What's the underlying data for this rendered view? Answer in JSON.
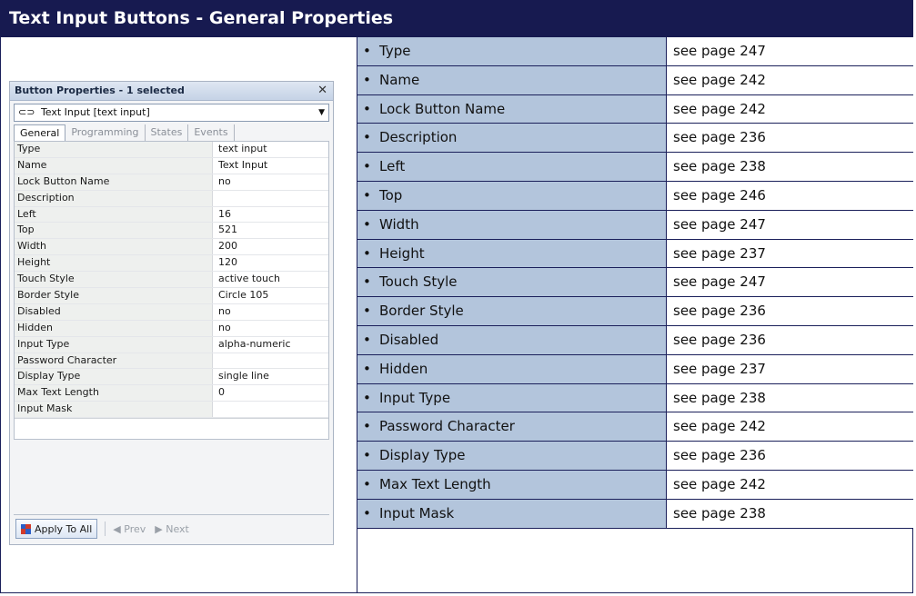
{
  "page_title": "Text Input Buttons - General Properties",
  "panel": {
    "title": "Button Properties - 1 selected",
    "selector_value": "Text Input  [text input]",
    "tabs": [
      "General",
      "Programming",
      "States",
      "Events"
    ],
    "properties": [
      {
        "key": "Type",
        "value": "text input"
      },
      {
        "key": "Name",
        "value": "Text Input"
      },
      {
        "key": "Lock Button Name",
        "value": "no"
      },
      {
        "key": "Description",
        "value": ""
      },
      {
        "key": "Left",
        "value": "16"
      },
      {
        "key": "Top",
        "value": "521"
      },
      {
        "key": "Width",
        "value": "200"
      },
      {
        "key": "Height",
        "value": "120"
      },
      {
        "key": "Touch Style",
        "value": "active touch"
      },
      {
        "key": "Border Style",
        "value": "Circle 105"
      },
      {
        "key": "Disabled",
        "value": "no"
      },
      {
        "key": "Hidden",
        "value": "no"
      },
      {
        "key": "Input Type",
        "value": "alpha-numeric"
      },
      {
        "key": "Password Character",
        "value": ""
      },
      {
        "key": "Display Type",
        "value": "single line"
      },
      {
        "key": "Max Text Length",
        "value": "0"
      },
      {
        "key": "Input Mask",
        "value": ""
      }
    ],
    "apply_label": "Apply To All",
    "prev_label": "Prev",
    "next_label": "Next"
  },
  "references": [
    {
      "name": "Type",
      "page": "see page 247"
    },
    {
      "name": "Name",
      "page": "see page 242"
    },
    {
      "name": "Lock Button Name",
      "page": "see page 242"
    },
    {
      "name": "Description",
      "page": "see page 236"
    },
    {
      "name": "Left",
      "page": "see page 238"
    },
    {
      "name": "Top",
      "page": "see page 246"
    },
    {
      "name": "Width",
      "page": "see page 247"
    },
    {
      "name": "Height",
      "page": "see page 237"
    },
    {
      "name": "Touch Style",
      "page": "see page 247"
    },
    {
      "name": "Border Style",
      "page": "see page 236"
    },
    {
      "name": "Disabled",
      "page": "see page 236"
    },
    {
      "name": "Hidden",
      "page": "see page 237"
    },
    {
      "name": "Input Type",
      "page": "see page 238"
    },
    {
      "name": "Password Character",
      "page": "see page 242"
    },
    {
      "name": "Display Type",
      "page": "see page 236"
    },
    {
      "name": "Max Text Length",
      "page": "see page 242"
    },
    {
      "name": "Input Mask",
      "page": "see page 238"
    }
  ],
  "colors": {
    "title_bg": "#171a50",
    "name_cell_bg": "#b3c5dc"
  }
}
